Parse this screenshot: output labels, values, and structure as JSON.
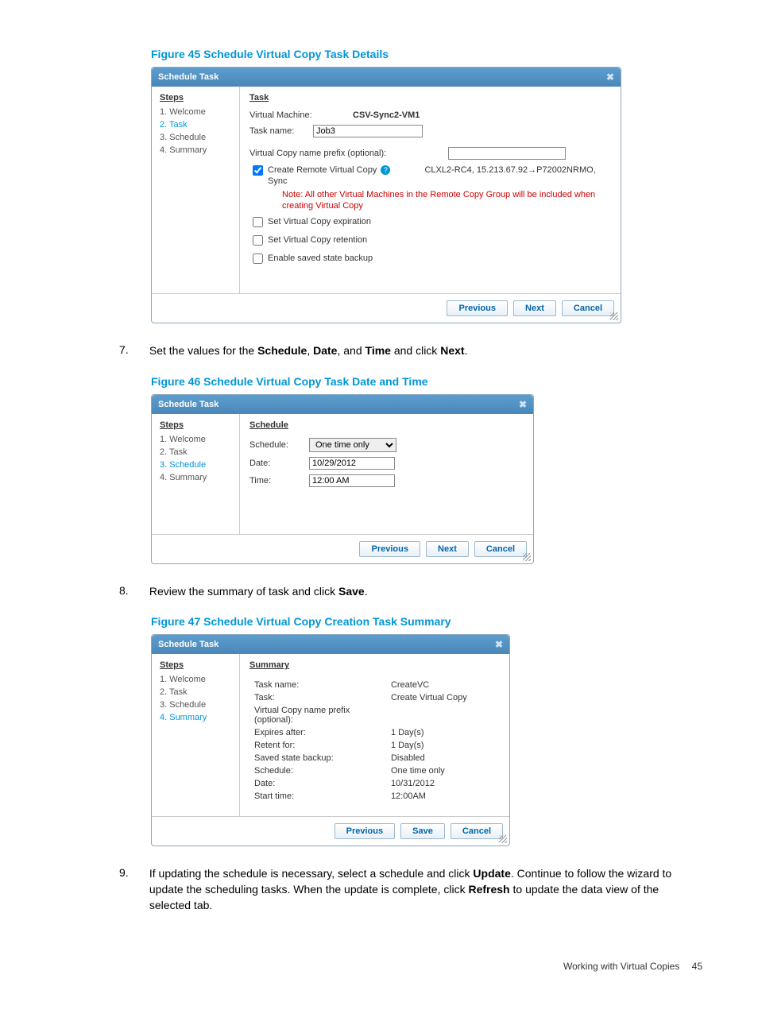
{
  "captions": {
    "fig45": "Figure 45 Schedule Virtual Copy Task Details",
    "fig46": "Figure 46 Schedule Virtual Copy Task Date and Time",
    "fig47": "Figure 47 Schedule Virtual Copy Creation Task Summary"
  },
  "steps_text": {
    "s7_num": "7.",
    "s7_pre": "Set the values for the ",
    "s7_b1": "Schedule",
    "s7_mid1": ", ",
    "s7_b2": "Date",
    "s7_mid2": ", and ",
    "s7_b3": "Time",
    "s7_mid3": " and click ",
    "s7_b4": "Next",
    "s7_end": ".",
    "s8_num": "8.",
    "s8_pre": "Review the summary of task and click ",
    "s8_b1": "Save",
    "s8_end": ".",
    "s9_num": "9.",
    "s9_pre": "If updating the schedule is necessary, select a schedule and click ",
    "s9_b1": "Update",
    "s9_mid1": ". Continue to follow the wizard to update the scheduling tasks. When the update is complete, click ",
    "s9_b2": "Refresh",
    "s9_end": " to update the data view of the selected tab."
  },
  "common": {
    "dlg_title": "Schedule Task",
    "steps_hdr": "Steps",
    "step1": "1. Welcome",
    "step2": "2. Task",
    "step3": "3. Schedule",
    "step4": "4. Summary",
    "btn_prev": "Previous",
    "btn_next": "Next",
    "btn_save": "Save",
    "btn_cancel": "Cancel"
  },
  "dlg45": {
    "content_hdr": "Task",
    "vm_lbl": "Virtual Machine:",
    "vm_val": "CSV-Sync2-VM1",
    "taskname_lbl": "Task name:",
    "taskname_val": "Job3",
    "vcprefix_lbl": "Virtual Copy name prefix (optional):",
    "vcprefix_val": "",
    "chk1": " Create Remote Virtual Copy ",
    "chk1_info": "CLXL2-RC4, 15.213.67.92→P72002NRMO, Sync",
    "chk1_note": "Note: All other Virtual Machines in the Remote Copy Group will be included when creating Virtual Copy",
    "chk2": " Set Virtual Copy expiration",
    "chk3": " Set Virtual Copy retention",
    "chk4": "Enable saved state backup"
  },
  "dlg46": {
    "content_hdr": "Schedule",
    "sched_lbl": "Schedule:",
    "sched_val": "One time only",
    "date_lbl": "Date:",
    "date_val": "10/29/2012",
    "time_lbl": "Time:",
    "time_val": "12:00 AM"
  },
  "dlg47": {
    "content_hdr": "Summary",
    "rows": [
      [
        "Task name:",
        "CreateVC"
      ],
      [
        "Task:",
        "Create Virtual Copy"
      ],
      [
        "Virtual Copy name prefix (optional):",
        ""
      ],
      [
        "Expires after:",
        "1 Day(s)"
      ],
      [
        "Retent for:",
        "1 Day(s)"
      ],
      [
        "Saved state backup:",
        "Disabled"
      ],
      [
        "Schedule:",
        "One time only"
      ],
      [
        "Date:",
        "10/31/2012"
      ],
      [
        "Start time:",
        "12:00AM"
      ]
    ]
  },
  "footer": {
    "section": "Working with Virtual Copies",
    "page": "45"
  }
}
